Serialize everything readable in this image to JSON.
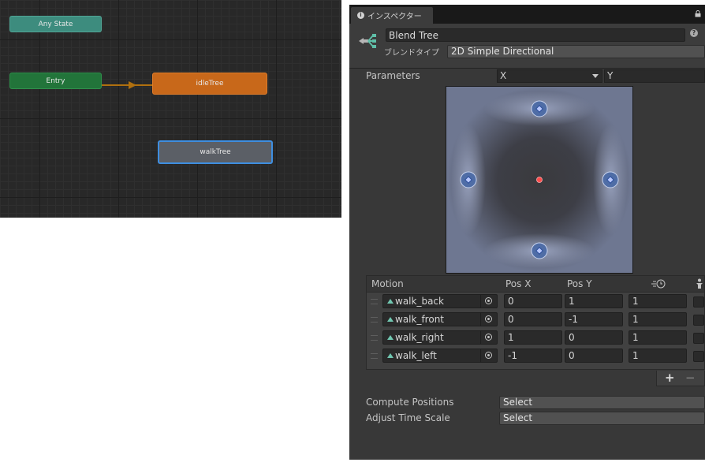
{
  "animator": {
    "nodes": {
      "any_state": "Any State",
      "entry": "Entry",
      "idle_tree": "idleTree",
      "walk_tree": "walkTree"
    },
    "colors": {
      "any_state": "#3d8c7e",
      "entry": "#22743a",
      "default_state": "#c8681a",
      "selected_outline": "#3e8ee0",
      "transition": "#b0700f"
    }
  },
  "inspector": {
    "tab_label": "インスペクター",
    "object_name": "Blend Tree",
    "blend_type_label": "ブレンドタイプ",
    "blend_type_value": "2D Simple Directional",
    "parameters_label": "Parameters",
    "param_x": "X",
    "param_y": "Y",
    "blend_graph": {
      "range": [
        -1,
        1
      ],
      "motion_points": [
        {
          "x": 0,
          "y": 1
        },
        {
          "x": 0,
          "y": -1
        },
        {
          "x": 1,
          "y": 0
        },
        {
          "x": -1,
          "y": 0
        }
      ],
      "current_point": {
        "x": 0,
        "y": 0
      }
    },
    "table": {
      "headers": {
        "motion": "Motion",
        "pos_x": "Pos X",
        "pos_y": "Pos Y"
      },
      "rows": [
        {
          "motion": "walk_back",
          "pos_x": "0",
          "pos_y": "1",
          "speed": "1"
        },
        {
          "motion": "walk_front",
          "pos_x": "0",
          "pos_y": "-1",
          "speed": "1"
        },
        {
          "motion": "walk_right",
          "pos_x": "1",
          "pos_y": "0",
          "speed": "1"
        },
        {
          "motion": "walk_left",
          "pos_x": "-1",
          "pos_y": "0",
          "speed": "1"
        }
      ],
      "add_symbol": "+",
      "remove_symbol": "−"
    },
    "compute_positions_label": "Compute Positions",
    "compute_positions_value": "Select",
    "adjust_time_scale_label": "Adjust Time Scale",
    "adjust_time_scale_value": "Select"
  }
}
